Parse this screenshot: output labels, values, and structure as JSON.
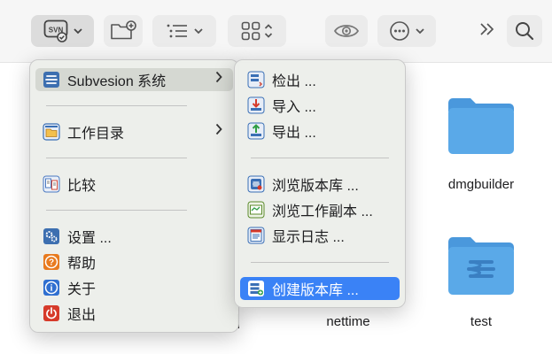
{
  "toolbar": {
    "svn_icon_label": "SVN"
  },
  "files": [
    {
      "name": "dmgbuilder"
    },
    {
      "name": "nettime"
    },
    {
      "name": "test"
    }
  ],
  "main_menu": {
    "items": [
      {
        "label": "Subvesion 系统",
        "has_submenu": true
      },
      {
        "label": "工作目录",
        "has_submenu": true
      },
      {
        "label": "比较"
      },
      {
        "label": "设置 ..."
      },
      {
        "label": "帮助"
      },
      {
        "label": "关于"
      },
      {
        "label": "退出"
      }
    ]
  },
  "submenu": {
    "items": [
      {
        "label": "检出 ..."
      },
      {
        "label": "导入 ..."
      },
      {
        "label": "导出 ..."
      },
      {
        "label": "浏览版本库 ..."
      },
      {
        "label": "浏览工作副本 ..."
      },
      {
        "label": "显示日志 ..."
      },
      {
        "label": "创建版本库 ..."
      }
    ]
  },
  "colors": {
    "accent": "#3a82f6",
    "folder": "#5aa9e8"
  }
}
